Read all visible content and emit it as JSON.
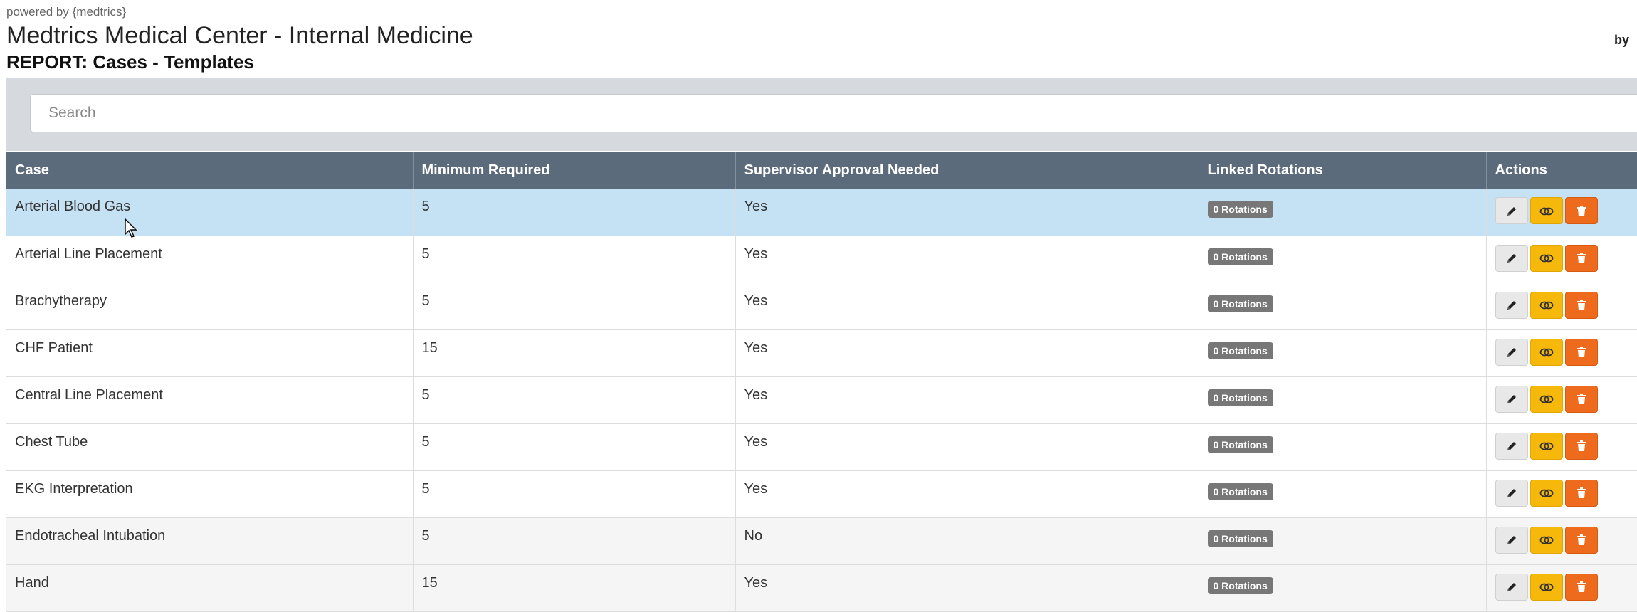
{
  "header": {
    "powered_by": "powered by {medtrics}",
    "title": "Medtrics Medical Center - Internal Medicine",
    "subtitle": "REPORT: Cases - Templates",
    "corner_text": "by"
  },
  "search": {
    "placeholder": "Search"
  },
  "table": {
    "columns": [
      "Case",
      "Minimum Required",
      "Supervisor Approval Needed",
      "Linked Rotations",
      "Actions"
    ],
    "rows": [
      {
        "case": "Arterial Blood Gas",
        "minimum": "5",
        "approval": "Yes",
        "rotations": "0 Rotations"
      },
      {
        "case": "Arterial Line Placement",
        "minimum": "5",
        "approval": "Yes",
        "rotations": "0 Rotations"
      },
      {
        "case": "Brachytherapy",
        "minimum": "5",
        "approval": "Yes",
        "rotations": "0 Rotations"
      },
      {
        "case": "CHF Patient",
        "minimum": "15",
        "approval": "Yes",
        "rotations": "0 Rotations"
      },
      {
        "case": "Central Line Placement",
        "minimum": "5",
        "approval": "Yes",
        "rotations": "0 Rotations"
      },
      {
        "case": "Chest Tube",
        "minimum": "5",
        "approval": "Yes",
        "rotations": "0 Rotations"
      },
      {
        "case": "EKG Interpretation",
        "minimum": "5",
        "approval": "Yes",
        "rotations": "0 Rotations"
      },
      {
        "case": "Endotracheal Intubation",
        "minimum": "5",
        "approval": "No",
        "rotations": "0 Rotations"
      },
      {
        "case": "Hand",
        "minimum": "15",
        "approval": "Yes",
        "rotations": "0 Rotations"
      }
    ],
    "selected_row": 0
  },
  "icons": {
    "edit": "pencil-icon",
    "link": "link-icon",
    "delete": "trash-icon"
  },
  "colors": {
    "header_bg": "#5b6b7c",
    "selected_row": "#c5e1f4",
    "badge": "#777777",
    "edit_btn": "#e8e8e8",
    "link_btn": "#f6b80b",
    "delete_btn": "#ee6a1c"
  }
}
